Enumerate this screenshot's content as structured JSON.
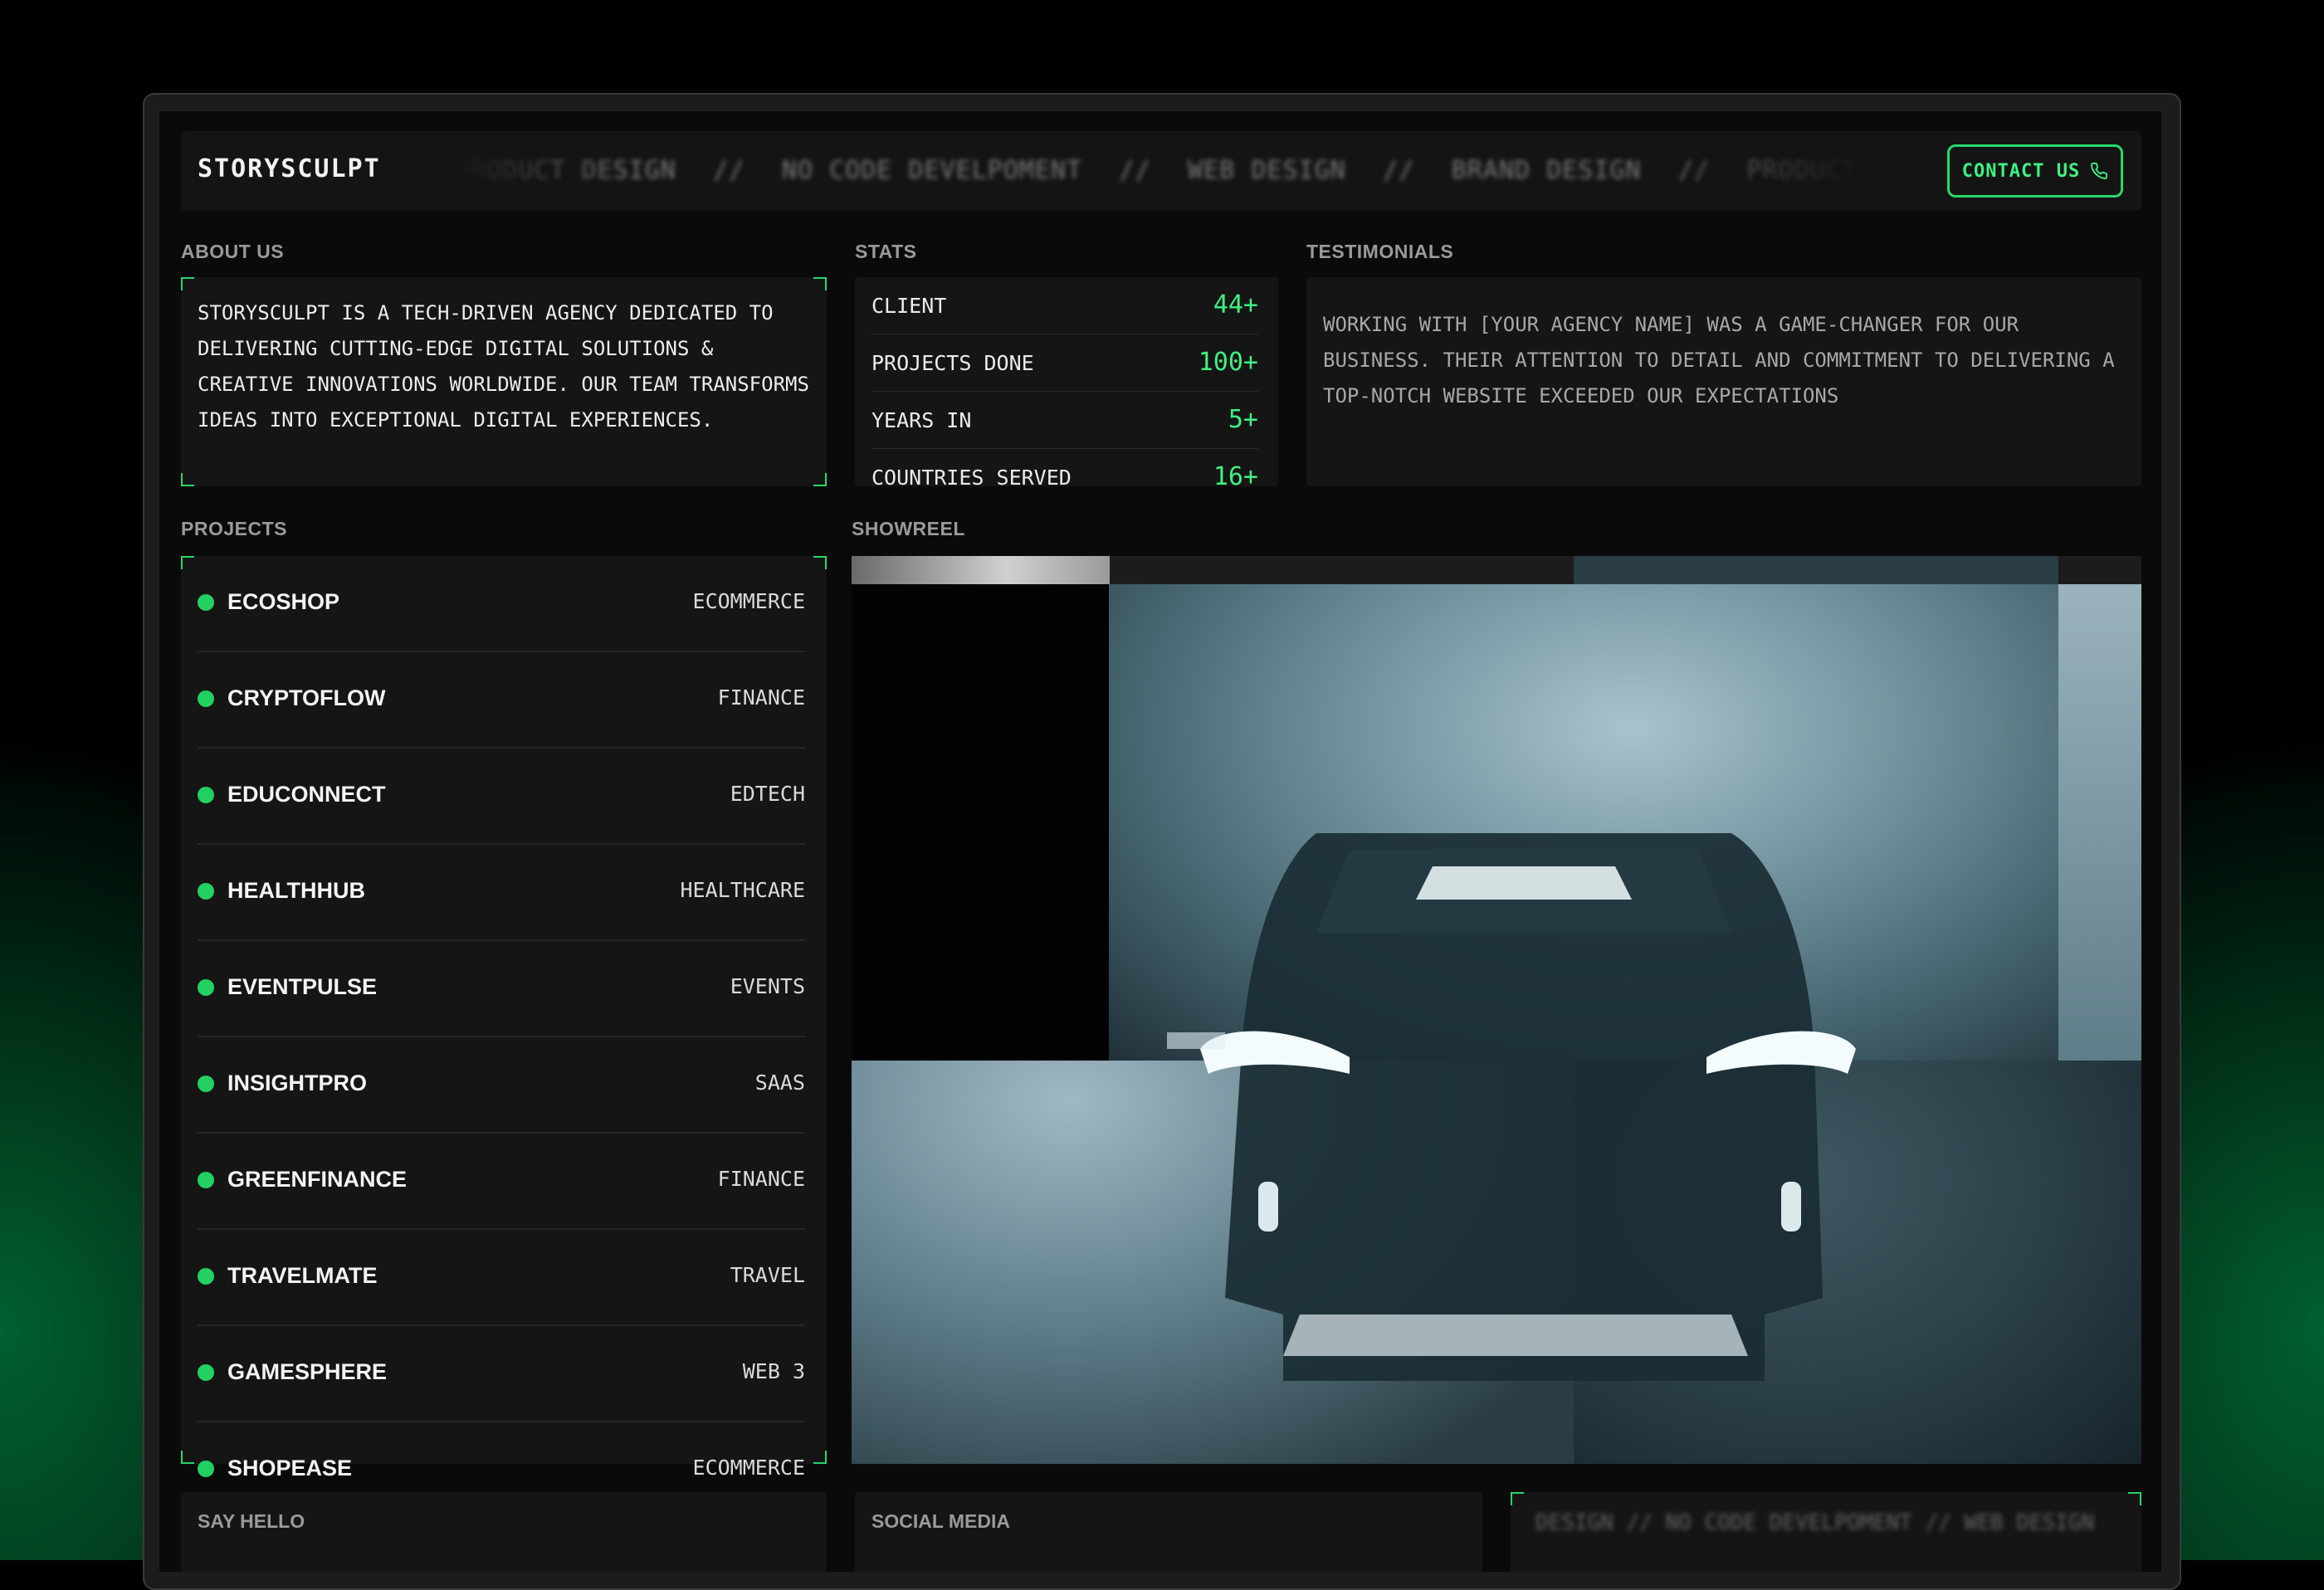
{
  "header": {
    "logo": "STORYSCULPT",
    "marquee": [
      "PRODUCT DESIGN",
      "//",
      "NO CODE DEVELPOMENT",
      "//",
      "WEB DESIGN",
      "//",
      "BRAND DESIGN",
      "//",
      "PRODUCT"
    ],
    "contact_label": "CONTACT US"
  },
  "about": {
    "label": "ABOUT US",
    "text": "STORYSCULPT IS A TECH-DRIVEN AGENCY DEDICATED TO DELIVERING CUTTING-EDGE DIGITAL SOLUTIONS & CREATIVE INNOVATIONS WORLDWIDE. OUR TEAM TRANSFORMS IDEAS INTO EXCEPTIONAL DIGITAL EXPERIENCES."
  },
  "stats": {
    "label": "STATS",
    "items": [
      {
        "label": "CLIENT",
        "value": "44+"
      },
      {
        "label": "PROJECTS DONE",
        "value": "100+"
      },
      {
        "label": "YEARS IN",
        "value": "5+"
      },
      {
        "label": "COUNTRIES SERVED",
        "value": "16+"
      }
    ]
  },
  "testimonials": {
    "label": "TESTIMONIALS",
    "text": "WORKING WITH [YOUR AGENCY NAME] WAS A GAME-CHANGER FOR OUR BUSINESS. THEIR ATTENTION TO DETAIL AND COMMITMENT TO DELIVERING A TOP-NOTCH WEBSITE EXCEEDED OUR EXPECTATIONS"
  },
  "projects": {
    "label": "PROJECTS",
    "items": [
      {
        "name": "ECOSHOP",
        "category": "ECOMMERCE"
      },
      {
        "name": "CRYPTOFLOW",
        "category": "FINANCE"
      },
      {
        "name": "EDUCONNECT",
        "category": "EDTECH"
      },
      {
        "name": "HEALTHHUB",
        "category": "HEALTHCARE"
      },
      {
        "name": "EVENTPULSE",
        "category": "EVENTS"
      },
      {
        "name": "INSIGHTPRO",
        "category": "SAAS"
      },
      {
        "name": "GREENFINANCE",
        "category": "FINANCE"
      },
      {
        "name": "TRAVELMATE",
        "category": "TRAVEL"
      },
      {
        "name": "GAMESPHERE",
        "category": "WEB 3"
      },
      {
        "name": "SHOPEASE",
        "category": "ECOMMERCE"
      }
    ]
  },
  "showreel": {
    "label": "SHOWREEL",
    "progress": 0.2
  },
  "footer": {
    "say_hello_label": "SAY HELLO",
    "social_label": "SOCIAL MEDIA",
    "marquee": "DESIGN // NO CODE DEVELPOMENT // WEB DESIGN"
  },
  "colors": {
    "accent": "#3ef282",
    "dot": "#22d160",
    "panel": "#151515",
    "background": "#0a0a0a"
  }
}
